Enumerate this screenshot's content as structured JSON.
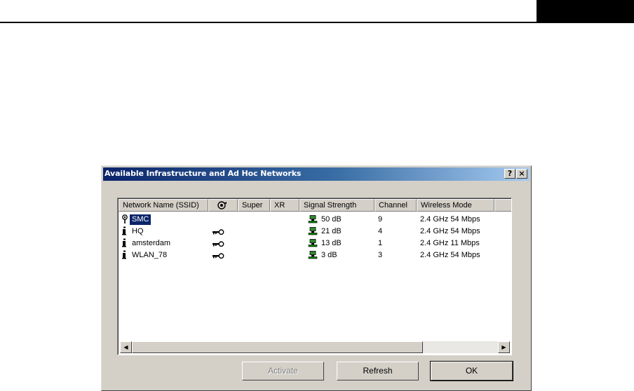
{
  "dialog": {
    "title": "Available Infrastructure and Ad Hoc Networks",
    "help_label": "?",
    "close_label": "×"
  },
  "columns": {
    "ssid": "Network Name (SSID)",
    "security_icon": "key-shield-icon",
    "super": "Super",
    "xr": "XR",
    "signal": "Signal Strength",
    "channel": "Channel",
    "mode": "Wireless Mode"
  },
  "networks": [
    {
      "ssid": "SMC",
      "type_icon": "access-point-icon",
      "secured": false,
      "signal": "50 dB",
      "channel": "9",
      "mode": "2.4 GHz 54 Mbps",
      "selected": true
    },
    {
      "ssid": "HQ",
      "type_icon": "adhoc-station-icon",
      "secured": true,
      "signal": "21 dB",
      "channel": "4",
      "mode": "2.4 GHz 54 Mbps",
      "selected": false
    },
    {
      "ssid": "amsterdam",
      "type_icon": "adhoc-station-icon",
      "secured": true,
      "signal": "13 dB",
      "channel": "1",
      "mode": "2.4 GHz 11 Mbps",
      "selected": false
    },
    {
      "ssid": "WLAN_78",
      "type_icon": "adhoc-station-icon",
      "secured": true,
      "signal": "3 dB",
      "channel": "3",
      "mode": "2.4 GHz 54 Mbps",
      "selected": false
    }
  ],
  "buttons": {
    "activate": "Activate",
    "refresh": "Refresh",
    "ok": "OK"
  },
  "colors": {
    "selection": "#0a246a",
    "signal_icon": "#008000"
  }
}
